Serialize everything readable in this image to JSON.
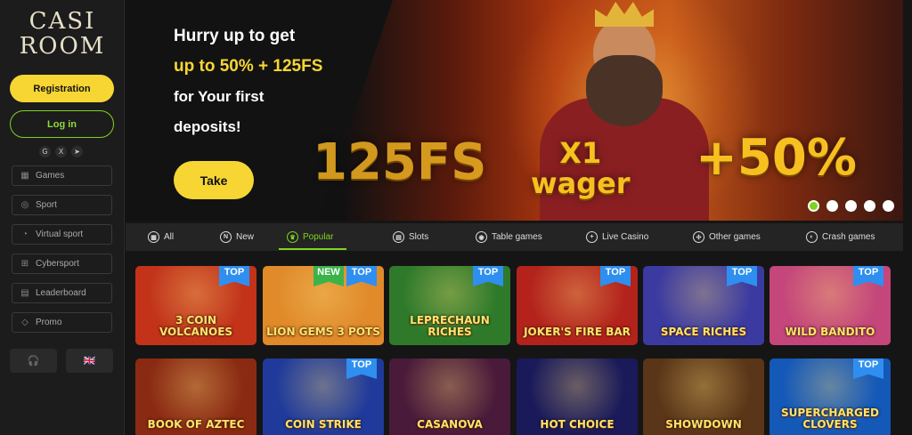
{
  "logo": {
    "line1": "CASI",
    "line2": "ROOM"
  },
  "sidebar": {
    "registration_label": "Registration",
    "login_label": "Log in",
    "social": [
      {
        "icon": "google-icon",
        "glyph": "G"
      },
      {
        "icon": "x-icon",
        "glyph": "X"
      },
      {
        "icon": "telegram-icon",
        "glyph": "➤"
      }
    ],
    "items": [
      {
        "label": "Games",
        "icon": "games-icon",
        "glyph": "▦"
      },
      {
        "label": "Sport",
        "icon": "ball-icon",
        "glyph": "◎"
      },
      {
        "label": "Virtual sport",
        "icon": "virtual-sport-icon",
        "glyph": "◔"
      },
      {
        "label": "Cybersport",
        "icon": "gamepad-icon",
        "glyph": "⊞"
      },
      {
        "label": "Leaderboard",
        "icon": "leaderboard-icon",
        "glyph": "▤"
      },
      {
        "label": "Promo",
        "icon": "diamond-icon",
        "glyph": "◇"
      }
    ],
    "support_glyph": "🎧",
    "language_glyph": "🇬🇧"
  },
  "banner": {
    "line1": "Hurry up to get",
    "line2": "up to 50% + 125FS",
    "line3": "for Your first",
    "line4": "deposits!",
    "take_label": "Take",
    "big_fs": "125FS",
    "wager_top": "X1",
    "wager_bottom": "wager",
    "big_pct": "+50%",
    "slides": 5,
    "active_slide": 1
  },
  "tabs": [
    {
      "label": "All",
      "icon": "grid-icon",
      "glyph": "▦"
    },
    {
      "label": "New",
      "icon": "new-icon",
      "glyph": "N"
    },
    {
      "label": "Popular",
      "icon": "popular-icon",
      "glyph": "♛",
      "active": true
    },
    {
      "label": "Slots",
      "icon": "slots-icon",
      "glyph": "▤"
    },
    {
      "label": "Table games",
      "icon": "table-games-icon",
      "glyph": "◉"
    },
    {
      "label": "Live Casino",
      "icon": "live-casino-icon",
      "glyph": "+"
    },
    {
      "label": "Other games",
      "icon": "other-games-icon",
      "glyph": "✣"
    },
    {
      "label": "Crash games",
      "icon": "crash-games-icon",
      "glyph": "◐"
    }
  ],
  "badges": {
    "top": "TOP",
    "new": "NEW"
  },
  "games": [
    {
      "name": "3 COIN VOLCANOES",
      "badge": "TOP",
      "bg": "#c2331a"
    },
    {
      "name": "LION GEMS 3 POTS",
      "badge": "TOP",
      "extra_badge": "NEW",
      "bg": "#e08a2a"
    },
    {
      "name": "LEPRECHAUN RICHES",
      "badge": "TOP",
      "bg": "#2e7a2a"
    },
    {
      "name": "JOKER'S FIRE BAR",
      "badge": "TOP",
      "bg": "#b3231c"
    },
    {
      "name": "SPACE RICHES",
      "badge": "TOP",
      "bg": "#3b3aa0"
    },
    {
      "name": "WILD BANDITO",
      "badge": "TOP",
      "bg": "#c4467a"
    },
    {
      "name": "BOOK OF AZTEC",
      "badge": "",
      "bg": "#8a2a12"
    },
    {
      "name": "COIN STRIKE",
      "badge": "TOP",
      "bg": "#1f3a9a"
    },
    {
      "name": "CASANOVA",
      "badge": "",
      "bg": "#4a1a3a"
    },
    {
      "name": "HOT CHOICE",
      "badge": "",
      "bg": "#1a1a5a"
    },
    {
      "name": "SHOWDOWN",
      "badge": "",
      "bg": "#5a3518"
    },
    {
      "name": "SUPERCHARGED CLOVERS",
      "badge": "TOP",
      "bg": "#1458b8"
    }
  ]
}
